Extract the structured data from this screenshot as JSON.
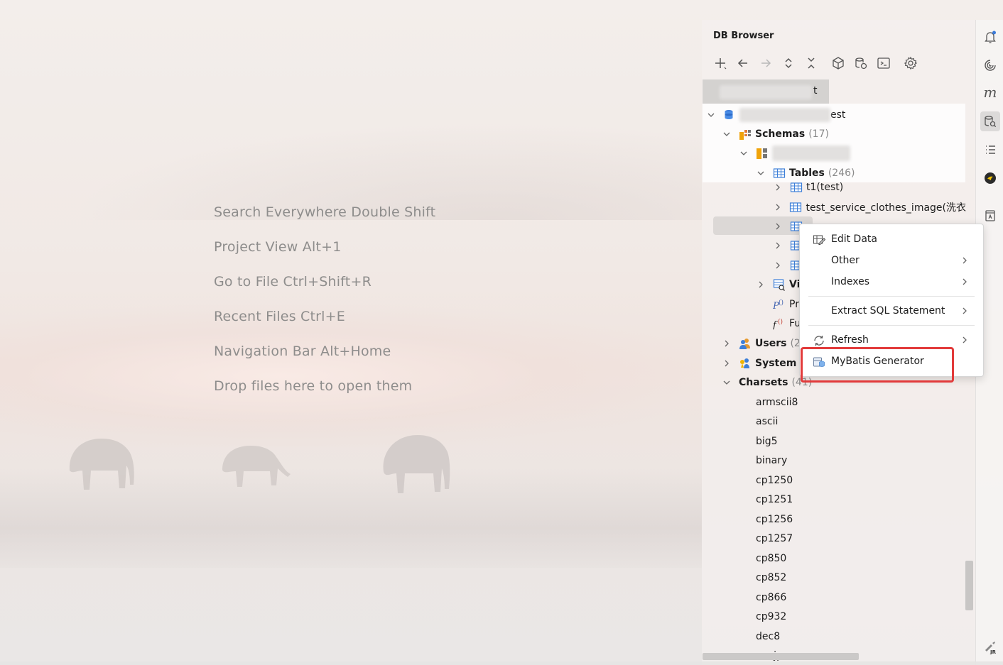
{
  "editor_hints": [
    {
      "label": "Search Everywhere Double Shift"
    },
    {
      "label": "Project View Alt+1"
    },
    {
      "label": "Go to File Ctrl+Shift+R"
    },
    {
      "label": "Recent Files Ctrl+E"
    },
    {
      "label": "Navigation Bar Alt+Home"
    },
    {
      "label": "Drop files here to open them"
    }
  ],
  "panel": {
    "title": "DB Browser",
    "toolbar": [
      "add-icon",
      "back-icon",
      "forward-icon",
      "expand-icon",
      "collapse-icon",
      "schema-icon",
      "db-settings-icon",
      "console-icon",
      "settings-icon"
    ],
    "connection_label": "t"
  },
  "tree": {
    "root_suffix": "est",
    "schemas": {
      "label": "Schemas",
      "count": "(17)"
    },
    "tables": {
      "label": "Tables",
      "count": "(246)"
    },
    "table_items": [
      {
        "label": "t1(test)"
      },
      {
        "label": "test_service_clothes_image(洗衣"
      }
    ],
    "views_partial": "Vi",
    "procedures_partial": "Pr",
    "functions_partial": "Fu",
    "users": {
      "label": "Users",
      "count": "(2"
    },
    "system": {
      "label": "System",
      "count": "("
    },
    "charsets": {
      "label": "Charsets",
      "count": "(41)"
    },
    "charset_items": [
      "armscii8",
      "ascii",
      "big5",
      "binary",
      "cp1250",
      "cp1251",
      "cp1256",
      "cp1257",
      "cp850",
      "cp852",
      "cp866",
      "cp932",
      "dec8",
      "eucjpms"
    ]
  },
  "context_menu": {
    "items": [
      {
        "label": "Edit Data",
        "icon": "edit-data-icon",
        "submenu": false
      },
      {
        "label": "Other",
        "icon": "",
        "submenu": true
      },
      {
        "label": "Indexes",
        "icon": "",
        "submenu": true
      },
      {
        "label": "Extract SQL Statement",
        "icon": "",
        "submenu": true
      },
      {
        "label": "Refresh",
        "icon": "refresh-icon",
        "submenu": true
      },
      {
        "label": "MyBatis Generator",
        "icon": "mybatis-icon",
        "submenu": false
      }
    ],
    "highlighted": "MyBatis Generator",
    "highlight_color": "#e23a3a"
  },
  "right_strip": [
    "notifications-icon",
    "ai-assistant-icon",
    "maven-icon",
    "db-browser-icon",
    "structure-icon",
    "plugin-icon",
    "bookmarks-icon",
    "jrebel-icon"
  ]
}
